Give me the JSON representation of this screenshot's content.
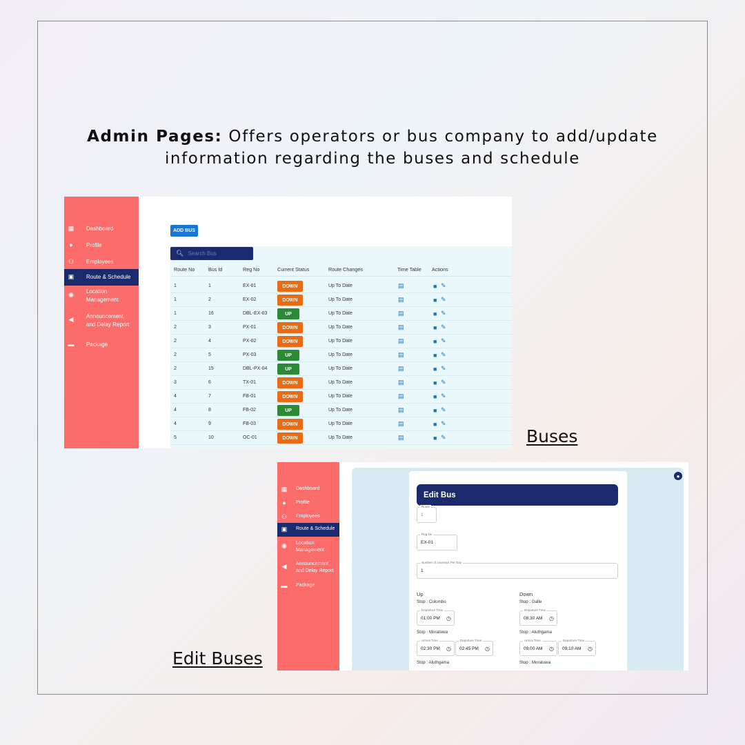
{
  "heading": {
    "bold": "Admin Pages:",
    "line1_rest": " Offers operators or bus company to add/update",
    "line2": "information regarding the buses and schedule"
  },
  "captions": {
    "buses": "Buses",
    "edit_buses": "Edit Buses"
  },
  "sidebar": {
    "items": [
      {
        "label_line1": "Dashboard",
        "label_line2": "",
        "icon": "dashboard-icon"
      },
      {
        "label_line1": "Profile",
        "label_line2": "",
        "icon": "profile-icon"
      },
      {
        "label_line1": "Employees",
        "label_line2": "",
        "icon": "employees-icon"
      },
      {
        "label_line1": "Route & Schedule",
        "label_line2": "",
        "icon": "bus-icon"
      },
      {
        "label_line1": "Location",
        "label_line2": "Management",
        "icon": "location-pin-icon"
      },
      {
        "label_line1": "Announcement",
        "label_line2": "and Delay Report",
        "icon": "megaphone-icon"
      },
      {
        "label_line1": "Package",
        "label_line2": "",
        "icon": "truck-icon"
      }
    ],
    "active_index": 3
  },
  "buses_page": {
    "add_button": "ADD BUS",
    "search_placeholder": "Search Bus",
    "columns": [
      "Route No",
      "Bus Id",
      "Reg No",
      "Current Status",
      "Route Changes",
      "Time Table",
      "Actions"
    ],
    "rows": [
      {
        "route": "1",
        "bus_id": "1",
        "reg": "EX-01",
        "status": "DOWN",
        "changes": "Up To Date"
      },
      {
        "route": "1",
        "bus_id": "2",
        "reg": "EX-02",
        "status": "DOWN",
        "changes": "Up To Date"
      },
      {
        "route": "1",
        "bus_id": "16",
        "reg": "DBL-EX-03",
        "status": "UP",
        "changes": "Up To Date"
      },
      {
        "route": "2",
        "bus_id": "3",
        "reg": "PX-01",
        "status": "DOWN",
        "changes": "Up To Date"
      },
      {
        "route": "2",
        "bus_id": "4",
        "reg": "PX-02",
        "status": "DOWN",
        "changes": "Up To Date"
      },
      {
        "route": "2",
        "bus_id": "5",
        "reg": "PX-03",
        "status": "UP",
        "changes": "Up To Date"
      },
      {
        "route": "2",
        "bus_id": "15",
        "reg": "DBL-PX-04",
        "status": "UP",
        "changes": "Up To Date"
      },
      {
        "route": "3",
        "bus_id": "6",
        "reg": "TX-01",
        "status": "DOWN",
        "changes": "Up To Date"
      },
      {
        "route": "4",
        "bus_id": "7",
        "reg": "FB-01",
        "status": "DOWN",
        "changes": "Up To Date"
      },
      {
        "route": "4",
        "bus_id": "8",
        "reg": "FB-02",
        "status": "UP",
        "changes": "Up To Date"
      },
      {
        "route": "4",
        "bus_id": "9",
        "reg": "FB-03",
        "status": "DOWN",
        "changes": "Up To Date"
      },
      {
        "route": "5",
        "bus_id": "10",
        "reg": "OC-01",
        "status": "DOWN",
        "changes": "Up To Date"
      }
    ],
    "status_colors": {
      "DOWN": "#ea6b12",
      "UP": "#2a8a35"
    }
  },
  "edit_page": {
    "title": "Edit Bus",
    "route_label": "Route",
    "route_value": "1",
    "reg_label": "Reg No",
    "reg_value": "EX-01",
    "journeys_label": "Number of Journeys Per Day",
    "journeys_value": "1",
    "up_title": "Up",
    "down_title": "Down",
    "departure_label": "Departure Time",
    "arrival_label": "Arrival Time",
    "up": {
      "stop1": "Stop : Colombo",
      "stop1_dep": "01:00 PM",
      "stop2": "Stop : Moratuwa",
      "stop2_arr": "02:30 PM",
      "stop2_dep": "02:45 PM",
      "stop3": "Stop : Aluthgama"
    },
    "down": {
      "stop1": "Stop : Galle",
      "stop1_dep": "08:30 AM",
      "stop2": "Stop : Aluthgama",
      "stop2_arr": "09:00 AM",
      "stop2_dep": "09:10 AM",
      "stop3": "Stop : Moratuwa"
    }
  }
}
